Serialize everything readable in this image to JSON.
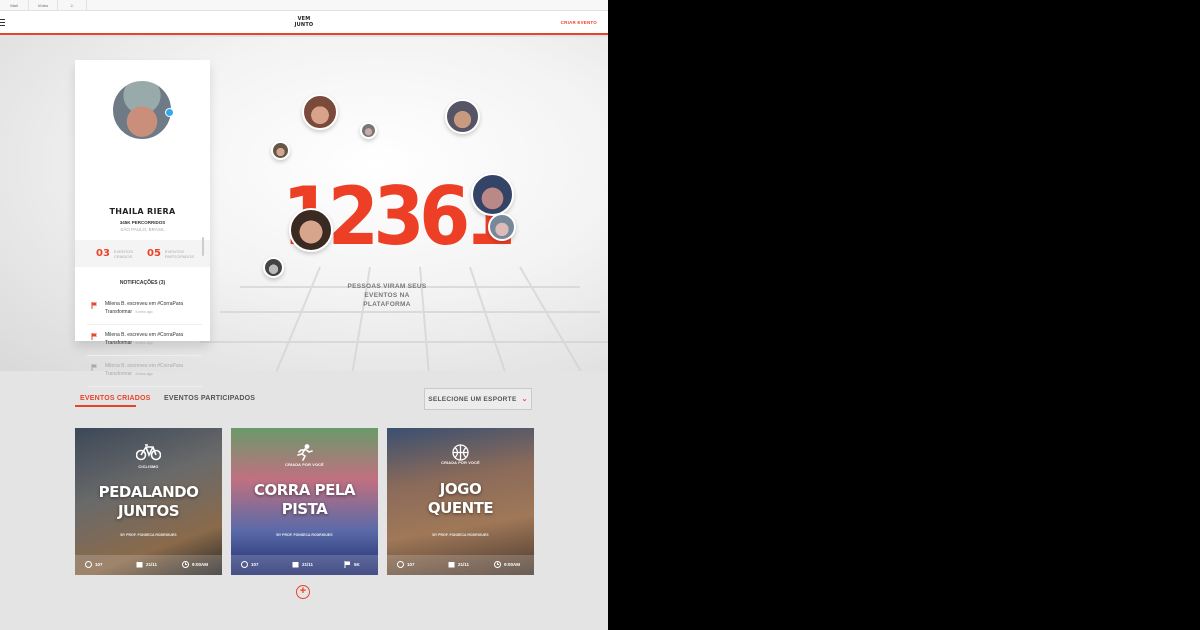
{
  "browser_tabs": [
    "Mail",
    "Vídeo",
    "J."
  ],
  "header": {
    "logo_line1": "VEM",
    "logo_line2": "JUNTO",
    "create_event": "CRIAR EVENTO"
  },
  "profile": {
    "name": "THAILA RIERA",
    "distance": "345K PERCORRIDOS",
    "location": "SÃO PAULO, BRASIL",
    "stats": [
      {
        "value": "03",
        "label_line1": "EVENTOS",
        "label_line2": "CRIADOS"
      },
      {
        "value": "05",
        "label_line1": "EVENTOS",
        "label_line2": "PARTICIPADOS"
      }
    ],
    "notifications_title": "NOTIFICAÇÕES (3)",
    "notifications": [
      {
        "line1": "Milena B. escreveu em #CorraPara",
        "line2": "Transformar",
        "time": "5 mins ago"
      },
      {
        "line1": "Milena B. escreveu em #CorraPara",
        "line2": "Transformar",
        "time": "5 mins ago"
      },
      {
        "line1": "Milena B. escreveu em #CorraPara",
        "line2": "Transformar",
        "time": "5 mins ago"
      }
    ]
  },
  "hero": {
    "counter": "12361",
    "caption_line1": "PESSOAS VIRAM SEUS",
    "caption_line2": "EVENTOS NA PLATAFORMA"
  },
  "events": {
    "tab_created": "EVENTOS CRIADOS",
    "tab_joined": "EVENTOS PARTICIPADOS",
    "sport_select": "SELECIONE UM ESPORTE",
    "cards": [
      {
        "category": "CICLISMO",
        "title_line1": "PEDALANDO",
        "title_line2": "JUNTOS",
        "author": "BY PROF. FONSECA RODRIGUES",
        "participants": "107",
        "date": "21/11",
        "extra": "9:00AM",
        "icon": "bicycle-icon",
        "extra_icon": "clock-icon"
      },
      {
        "category": "CRIADA POR VOCÊ",
        "title_line1": "CORRA PELA",
        "title_line2": "PISTA",
        "author": "BY PROF. FONSECA RODRIGUES",
        "participants": "107",
        "date": "21/11",
        "extra": "5K",
        "icon": "runner-icon",
        "extra_icon": "flag-icon"
      },
      {
        "category": "CRIADA POR VOCÊ",
        "title_line1": "JOGO",
        "title_line2": "QUENTE",
        "author": "BY PROF. FONSECA RODRIGUES",
        "participants": "107",
        "date": "21/11",
        "extra": "9:00AM",
        "icon": "basketball-icon",
        "extra_icon": "clock-icon"
      }
    ]
  },
  "colors": {
    "accent": "#e8442c",
    "counter": "#ec3f26"
  }
}
